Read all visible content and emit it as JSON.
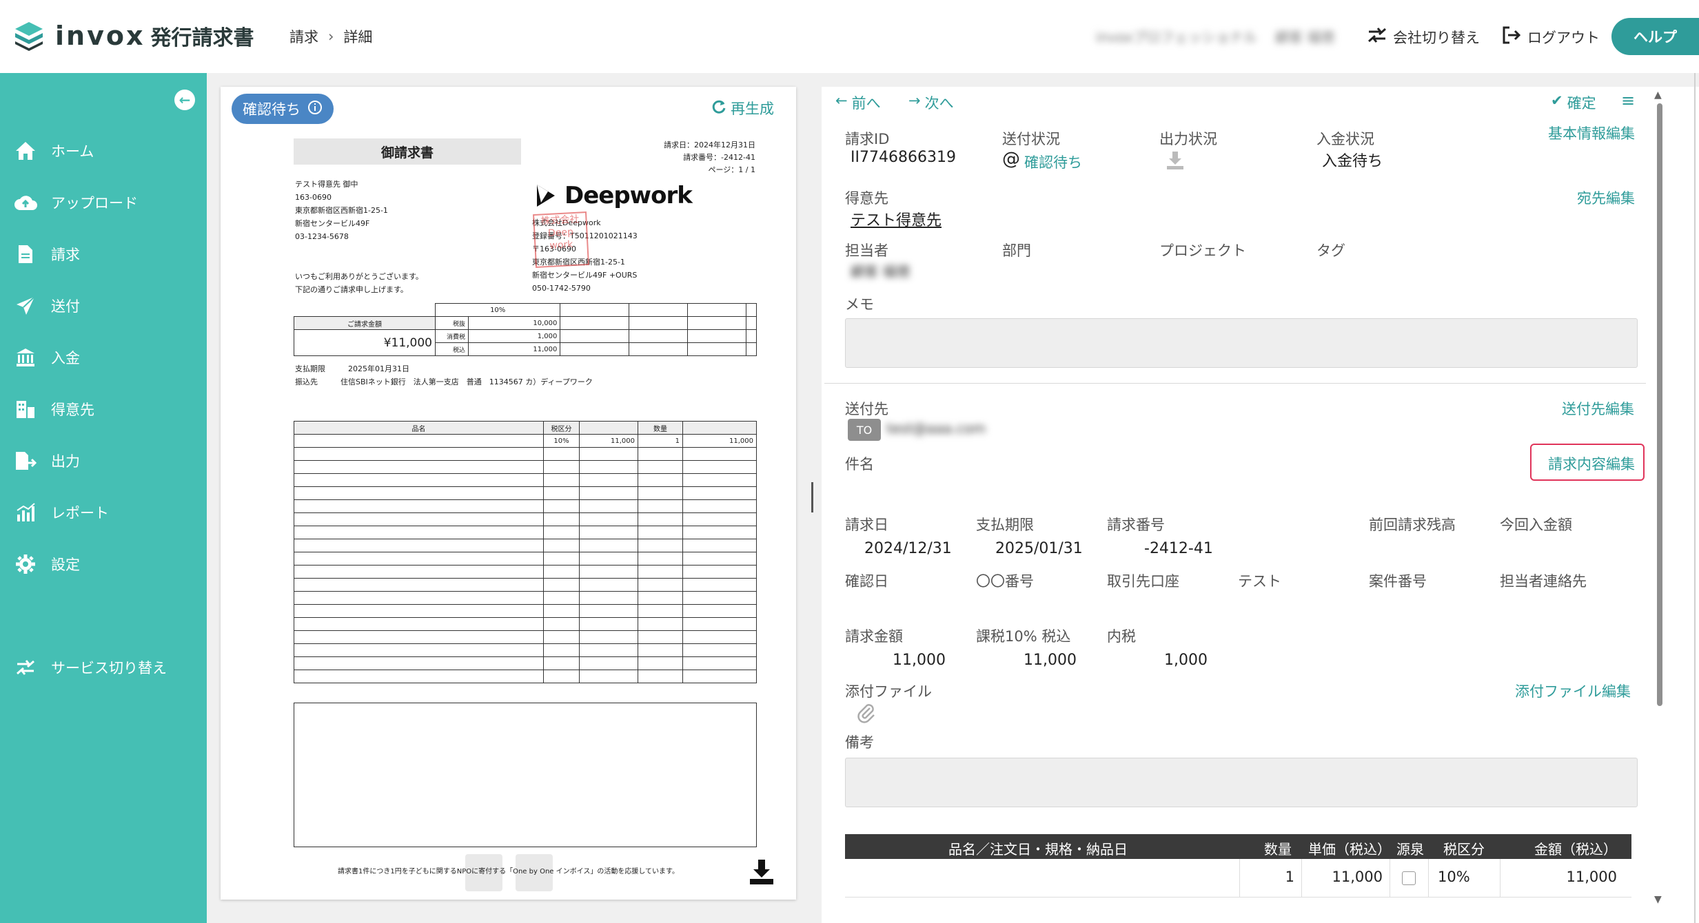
{
  "app": {
    "brand": "invox",
    "product": "発行請求書",
    "breadcrumb": [
      "請求",
      "詳細"
    ],
    "user_company": "invoxプロフェッショナル",
    "user_name": "顧客 福徳",
    "switch_company": "会社切り替え",
    "logout": "ログアウト",
    "help": "ヘルプ"
  },
  "sidebar": {
    "items": [
      {
        "label": "ホーム",
        "icon": "home-icon"
      },
      {
        "label": "アップロード",
        "icon": "cloud-upload-icon"
      },
      {
        "label": "請求",
        "icon": "document-icon"
      },
      {
        "label": "送付",
        "icon": "send-icon"
      },
      {
        "label": "入金",
        "icon": "bank-icon"
      },
      {
        "label": "得意先",
        "icon": "building-icon"
      },
      {
        "label": "出力",
        "icon": "export-icon"
      },
      {
        "label": "レポート",
        "icon": "chart-icon"
      },
      {
        "label": "設定",
        "icon": "gear-icon"
      }
    ],
    "service_switch": "サービス切り替え"
  },
  "preview": {
    "status": "確認待ち",
    "regenerate": "再生成",
    "doc": {
      "title": "御請求書",
      "meta": [
        "請求日：2024年12月31日",
        "請求番号：-2412-41",
        "ページ：1 / 1"
      ],
      "address": [
        "テスト得意先 御中",
        "163-0690",
        "東京都新宿区西新宿1-25-1",
        "新宿センタービル49F",
        "03-1234-5678"
      ],
      "greeting": [
        "いつもご利用ありがとうございます。",
        "下記の通りご請求申し上げます。"
      ],
      "issuer_logo": "Deepwork",
      "issuer": [
        "株式会社Deepwork",
        "登録番号：T5011201021143",
        "〒163-0690",
        "東京都新宿区西新宿1-25-1",
        "新宿センタービル49F +OURS",
        "050-1742-5790"
      ],
      "stamp": "株式会社 Deep work",
      "summary_rate": "10%",
      "summary_label": "ご請求金額",
      "summary_amount": "¥11,000",
      "summary_rows": [
        {
          "label": "税抜",
          "value": "10,000"
        },
        {
          "label": "消費税",
          "value": "1,000"
        },
        {
          "label": "税込",
          "value": "11,000"
        }
      ],
      "pay_due_label": "支払期限",
      "pay_due": "2025年01月31日",
      "bank_label": "振込先",
      "bank": "住信SBIネット銀行　法人第一支店　普通　1134567 カ）ディープワーク",
      "item_headers": [
        "品名",
        "税区分",
        "数量"
      ],
      "item_row": {
        "rate": "10%",
        "unit": "11,000",
        "qty": "1",
        "amount": "11,000"
      },
      "footer": "請求書1件につき1円を子どもに関するNPOに寄付する「One by One インボイス」の活動を応援しています。"
    }
  },
  "detail": {
    "prev": "前へ",
    "next": "次へ",
    "confirm": "確定",
    "fields": {
      "invoice_id_label": "請求ID",
      "invoice_id": "II7746866319",
      "send_status_label": "送付状況",
      "send_status": "確認待ち",
      "output_status_label": "出力状況",
      "payment_status_label": "入金状況",
      "payment_status": "入金待ち",
      "basic_edit": "基本情報編集",
      "client_label": "得意先",
      "client": "テスト得意先",
      "address_edit": "宛先編集",
      "owner_label": "担当者",
      "owner": "顧客 福徳",
      "dept_label": "部門",
      "project_label": "プロジェクト",
      "tag_label": "タグ",
      "memo_label": "メモ",
      "send_to_label": "送付先",
      "send_to_edit": "送付先編集",
      "to_badge": "TO",
      "to_email": "test@aaa.com",
      "subject_label": "件名",
      "content_edit": "請求内容編集",
      "invoice_date_label": "請求日",
      "invoice_date": "2024/12/31",
      "due_label": "支払期限",
      "due": "2025/01/31",
      "number_label": "請求番号",
      "number": "-2412-41",
      "prev_balance_label": "前回請求残高",
      "this_payment_label": "今回入金額",
      "confirm_date_label": "確認日",
      "oo_number_label": "〇〇番号",
      "client_account_label": "取引先口座",
      "test_label": "テスト",
      "case_number_label": "案件番号",
      "owner_contact_label": "担当者連絡先",
      "amount_label": "請求金額",
      "amount": "11,000",
      "tax10_label": "課税10% 税込",
      "tax10": "11,000",
      "inner_tax_label": "内税",
      "inner_tax": "1,000",
      "attach_label": "添付ファイル",
      "attach_edit": "添付ファイル編集",
      "remarks_label": "備考"
    },
    "items_table": {
      "headers": [
        "品名／注文日・規格・納品日",
        "数量",
        "単価（税込）",
        "源泉",
        "税区分",
        "金額（税込）"
      ],
      "rows": [
        {
          "name": "",
          "qty": "1",
          "unit_price": "11,000",
          "rate": "10%",
          "amount": "11,000"
        }
      ]
    }
  },
  "colors": {
    "accent": "#45bfb4",
    "link": "#2f9c9a",
    "status_blue": "#4a86c5",
    "highlight": "#e0345a"
  }
}
